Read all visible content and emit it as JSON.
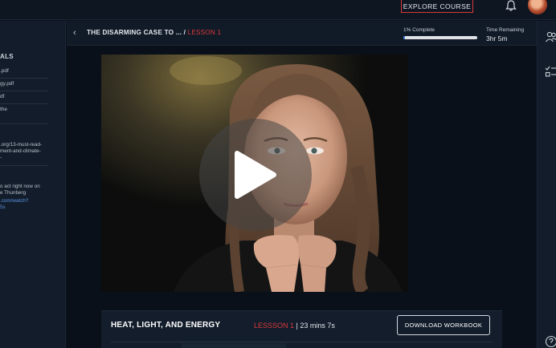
{
  "topbar": {
    "explore_label": "EXPLORE COURSE",
    "bell_icon": "bell-icon",
    "avatar_icon": "user-avatar"
  },
  "sidebar": {
    "heading": "ALS",
    "files": [
      ".pdf",
      "gy.pdf",
      "df",
      "the"
    ],
    "links": [
      ".org/13-must-read-",
      "ment-and-climate-",
      "-"
    ],
    "quote_lines": [
      "o act right now on",
      "e Thunberg"
    ],
    "video_link_lines": [
      ".com/watch?",
      "5s"
    ]
  },
  "lessonbar": {
    "back_icon": "chevron-left-icon",
    "course_title": "THE DISARMING CASE TO ... /",
    "lesson_label": "LESSON 1",
    "progress_label": "1% Complete",
    "progress_percent": 1,
    "time_label": "Time Remaining",
    "time_value": "3hr 5m"
  },
  "rightbar": {
    "icons": [
      "people-icon",
      "checklist-icon",
      "help-icon"
    ]
  },
  "video": {
    "play_icon": "play-icon"
  },
  "lesson_card": {
    "title": "HEAT, LIGHT, AND ENERGY",
    "lesson_tag": "LESSSON 1",
    "separator": "|",
    "duration": "23 mins 7s",
    "download_label": "DOWNLOAD WORKBOOK"
  },
  "colors": {
    "accent_red": "#d93a3a",
    "progress_blue": "#3b79d6",
    "background": "#0b121d"
  }
}
